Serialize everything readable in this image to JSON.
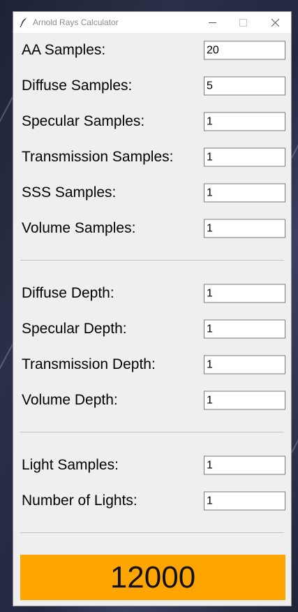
{
  "window": {
    "title": "Arnold Rays Calculator",
    "icons": {
      "app": "feather-icon",
      "minimize": "minimize-icon",
      "maximize": "maximize-icon",
      "close": "close-icon"
    }
  },
  "samples": [
    {
      "label": "AA Samples:",
      "value": "20"
    },
    {
      "label": "Diffuse Samples:",
      "value": "5"
    },
    {
      "label": "Specular Samples:",
      "value": "1"
    },
    {
      "label": "Transmission Samples:",
      "value": "1"
    },
    {
      "label": "SSS Samples:",
      "value": "1"
    },
    {
      "label": "Volume Samples:",
      "value": "1"
    }
  ],
  "depths": [
    {
      "label": "Diffuse Depth:",
      "value": "1"
    },
    {
      "label": "Specular Depth:",
      "value": "1"
    },
    {
      "label": "Transmission Depth:",
      "value": "1"
    },
    {
      "label": "Volume Depth:",
      "value": "1"
    }
  ],
  "lights": [
    {
      "label": "Light Samples:",
      "value": "1"
    },
    {
      "label": "Number of Lights:",
      "value": "1"
    }
  ],
  "result": {
    "value": "12000",
    "background_color": "#ffa500"
  },
  "colors": {
    "window_bg": "#efefef",
    "titlebar_bg": "#ffffff",
    "accent": "#ffa500"
  }
}
